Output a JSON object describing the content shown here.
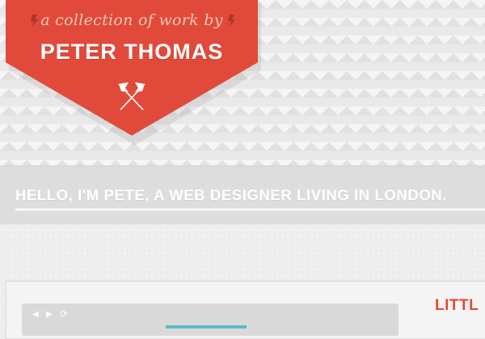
{
  "banner": {
    "tagline": "a collection of work by",
    "name": "PETER THOMAS"
  },
  "intro": {
    "text": "HELLO, I'M PETE, A WEB DESIGNER LIVING IN LONDON."
  },
  "portfolio": {
    "section_title": "LITTL",
    "browser_controls": {
      "back_icon": "◀",
      "forward_icon": "▶",
      "refresh_icon": "⟳"
    }
  },
  "colors": {
    "brand_red": "#e14a3a",
    "accent_teal": "#5bbdc7",
    "background": "#ececec"
  }
}
